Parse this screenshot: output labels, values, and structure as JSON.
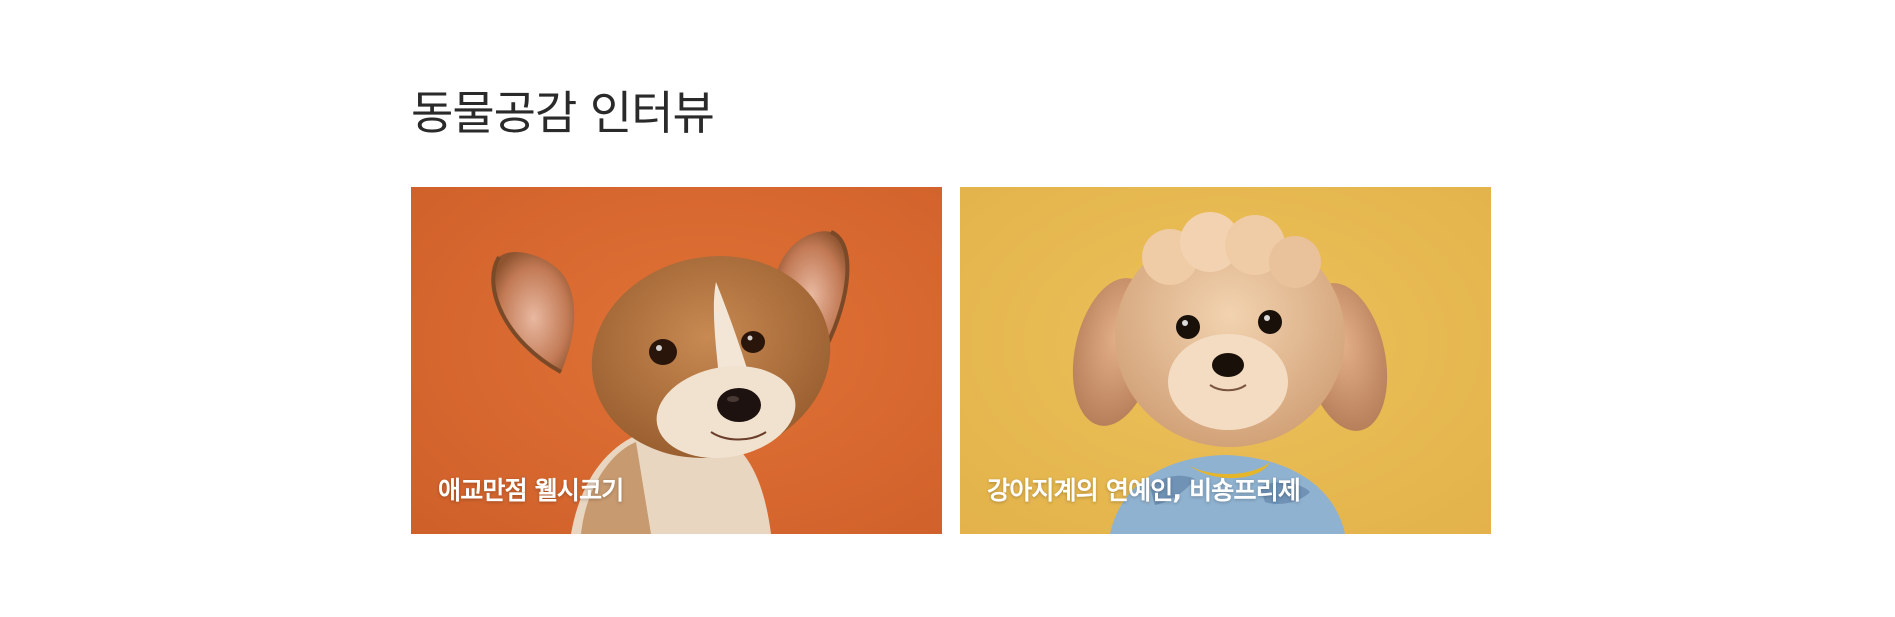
{
  "section": {
    "title": "동물공감 인터뷰"
  },
  "cards": [
    {
      "caption": "애교만점 웰시코기",
      "image": "welsh-corgi-puppy-photo",
      "background_color": "#dc6a2e"
    },
    {
      "caption": "강아지계의 연예인, 비숑프리제",
      "image": "fluffy-dog-in-shirt-photo",
      "background_color": "#e6b94e"
    }
  ]
}
